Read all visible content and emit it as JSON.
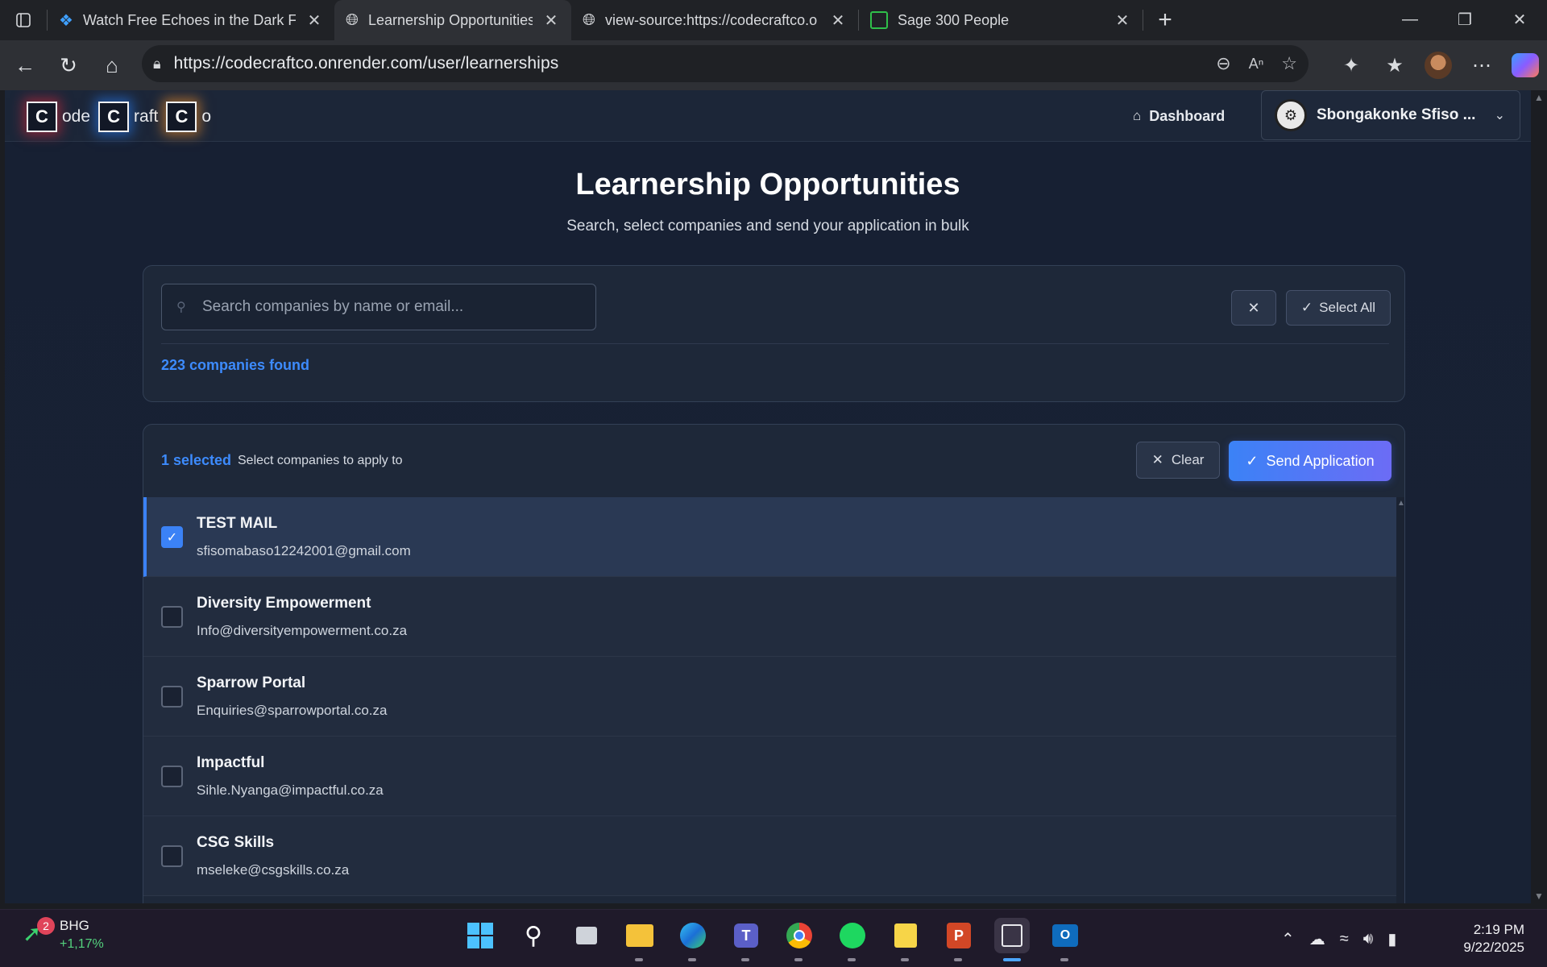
{
  "browser": {
    "tabs": [
      {
        "title": "Watch Free Echoes in the Dark Fu",
        "icon": "diamond-logo-icon",
        "active": false
      },
      {
        "title": "Learnership Opportunities - Code",
        "icon": "globe-icon",
        "active": true
      },
      {
        "title": "view-source:https://codecraftco.o",
        "icon": "globe-icon",
        "active": false
      },
      {
        "title": "Sage 300 People",
        "icon": "sage-icon",
        "active": false
      }
    ],
    "url": "https://codecraftco.onrender.com/user/learnerships"
  },
  "site": {
    "logo": {
      "l1": "C",
      "t1": "ode",
      "l2": "C",
      "t2": "raft",
      "l3": "C",
      "t3": "o"
    },
    "nav": {
      "dashboard": "Dashboard"
    },
    "user": {
      "name": "Sbongakonke Sfiso ..."
    }
  },
  "page": {
    "title": "Learnership Opportunities",
    "subtitle": "Search, select companies and send your application in bulk"
  },
  "search": {
    "placeholder": "Search companies by name or email...",
    "select_all": "Select All",
    "found": "223 companies found"
  },
  "list": {
    "selected_count": "1 selected",
    "hint": "Select companies to apply to",
    "clear": "Clear",
    "send": "Send Application",
    "companies": [
      {
        "name": "TEST MAIL",
        "email": "sfisomabaso12242001@gmail.com",
        "checked": true
      },
      {
        "name": "Diversity Empowerment",
        "email": "Info@diversityempowerment.co.za",
        "checked": false
      },
      {
        "name": "Sparrow Portal",
        "email": "Enquiries@sparrowportal.co.za",
        "checked": false
      },
      {
        "name": "Impactful",
        "email": "Sihle.Nyanga@impactful.co.za",
        "checked": false
      },
      {
        "name": "CSG Skills",
        "email": "mseleke@csgskills.co.za",
        "checked": false
      }
    ]
  },
  "taskbar": {
    "stock": {
      "badge": "2",
      "name": "BHG",
      "change": "+1,17%"
    },
    "time": "2:19 PM",
    "date": "9/22/2025"
  },
  "colors": {
    "accent": "#3b82f6",
    "page_bg": "#172033",
    "card_bg": "#1e2839"
  }
}
